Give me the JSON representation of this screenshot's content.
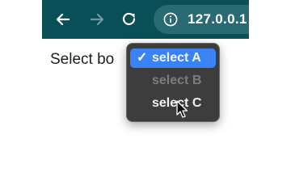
{
  "browser": {
    "address_bar": {
      "url": "127.0.0.1"
    },
    "icons": {
      "back": "back-arrow-icon",
      "forward": "forward-arrow-icon",
      "reload": "reload-icon",
      "site_info": "info-icon"
    },
    "colors": {
      "toolbar": "#0a4f57",
      "omnibox": "#2a6a72",
      "forward_disabled": "#6b9aa0"
    }
  },
  "page": {
    "select_label": "Select bo"
  },
  "dropdown": {
    "options": [
      {
        "label": "select A",
        "selected": true,
        "disabled": false
      },
      {
        "label": "select B",
        "selected": false,
        "disabled": true
      },
      {
        "label": "select C",
        "selected": false,
        "disabled": false
      }
    ],
    "checkmark": "✓",
    "colors": {
      "background": "#3d3d3d",
      "highlight": "#3b82f6",
      "disabled_text": "#7d7d7d"
    }
  }
}
